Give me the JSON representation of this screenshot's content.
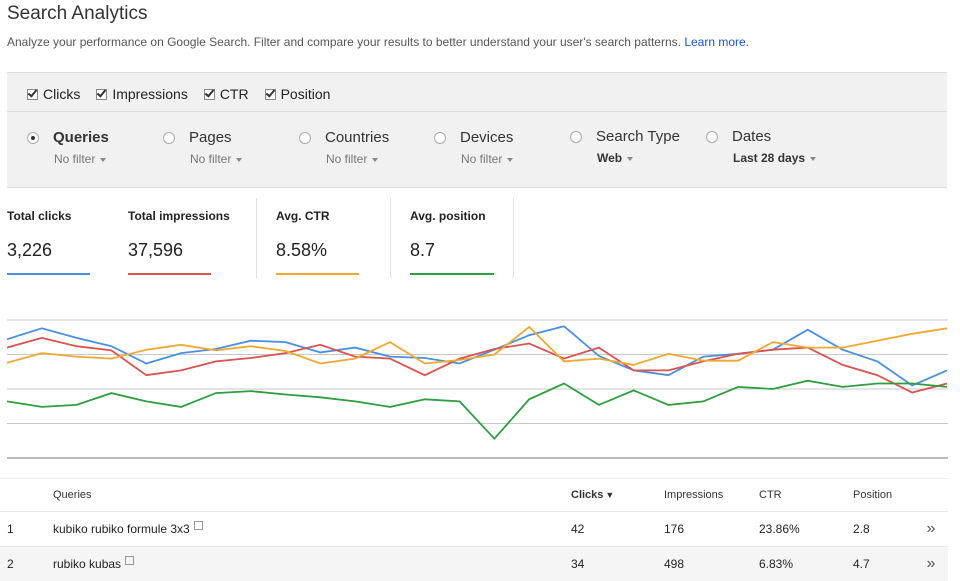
{
  "header": {
    "title": "Search Analytics",
    "subtitle": "Analyze your performance on Google Search. Filter and compare your results to better understand your user's search patterns.",
    "learn_more": "Learn more."
  },
  "metrics": [
    {
      "label": "Clicks",
      "checked": true
    },
    {
      "label": "Impressions",
      "checked": true
    },
    {
      "label": "CTR",
      "checked": true
    },
    {
      "label": "Position",
      "checked": true
    }
  ],
  "groups": [
    {
      "label": "Queries",
      "filter": "No filter",
      "selected": true
    },
    {
      "label": "Pages",
      "filter": "No filter",
      "selected": false
    },
    {
      "label": "Countries",
      "filter": "No filter",
      "selected": false
    },
    {
      "label": "Devices",
      "filter": "No filter",
      "selected": false
    },
    {
      "label": "Search Type",
      "filter": "Web",
      "selected": false
    },
    {
      "label": "Dates",
      "filter": "Last 28 days",
      "selected": false
    }
  ],
  "stats": [
    {
      "label": "Total clicks",
      "value": "3,226",
      "color": "#4a90e2"
    },
    {
      "label": "Total impressions",
      "value": "37,596",
      "color": "#d9534f"
    },
    {
      "label": "Avg. CTR",
      "value": "8.58%",
      "color": "#f0a830"
    },
    {
      "label": "Avg. position",
      "value": "8.7",
      "color": "#2e9e3e"
    }
  ],
  "chart_data": {
    "type": "line",
    "x": [
      1,
      2,
      3,
      4,
      5,
      6,
      7,
      8,
      9,
      10,
      11,
      12,
      13,
      14,
      15,
      16,
      17,
      18,
      19,
      20,
      21,
      22,
      23,
      24,
      25,
      26,
      27,
      28
    ],
    "series": [
      {
        "color": "#4a90e2",
        "values": [
          0.72,
          0.88,
          0.74,
          0.62,
          0.37,
          0.52,
          0.58,
          0.7,
          0.68,
          0.53,
          0.6,
          0.47,
          0.45,
          0.37,
          0.57,
          0.78,
          0.91,
          0.48,
          0.27,
          0.2,
          0.47,
          0.51,
          0.57,
          0.86,
          0.57,
          0.4,
          0.05,
          0.27
        ]
      },
      {
        "color": "#d9534f",
        "values": [
          0.6,
          0.74,
          0.62,
          0.56,
          0.2,
          0.27,
          0.4,
          0.45,
          0.52,
          0.64,
          0.47,
          0.44,
          0.2,
          0.44,
          0.58,
          0.66,
          0.44,
          0.6,
          0.27,
          0.27,
          0.4,
          0.51,
          0.57,
          0.6,
          0.35,
          0.2,
          -0.05,
          0.08
        ]
      },
      {
        "color": "#f0a830",
        "values": [
          0.38,
          0.52,
          0.47,
          0.44,
          0.57,
          0.64,
          0.56,
          0.62,
          0.55,
          0.37,
          0.44,
          0.68,
          0.37,
          0.42,
          0.5,
          0.9,
          0.4,
          0.44,
          0.35,
          0.51,
          0.41,
          0.41,
          0.68,
          0.6,
          0.6,
          0.7,
          0.8,
          0.88
        ]
      },
      {
        "color": "#2e9e3e",
        "values": [
          -0.18,
          -0.26,
          -0.23,
          -0.06,
          -0.18,
          -0.26,
          -0.06,
          -0.03,
          -0.08,
          -0.12,
          -0.18,
          -0.26,
          -0.15,
          -0.18,
          -0.72,
          -0.15,
          0.08,
          -0.23,
          -0.02,
          -0.23,
          -0.18,
          0.03,
          0.0,
          0.12,
          0.03,
          0.08,
          0.08,
          0.03
        ]
      }
    ],
    "grid": true
  },
  "table": {
    "columns": [
      "Queries",
      "Clicks",
      "Impressions",
      "CTR",
      "Position"
    ],
    "sorted": "Clicks",
    "rows": [
      {
        "n": "1",
        "query": "kubiko rubiko formule 3x3",
        "clicks": "42",
        "impressions": "176",
        "ctr": "23.86%",
        "position": "2.8"
      },
      {
        "n": "2",
        "query": "rubiko kubas",
        "clicks": "34",
        "impressions": "498",
        "ctr": "6.83%",
        "position": "4.7"
      }
    ]
  }
}
